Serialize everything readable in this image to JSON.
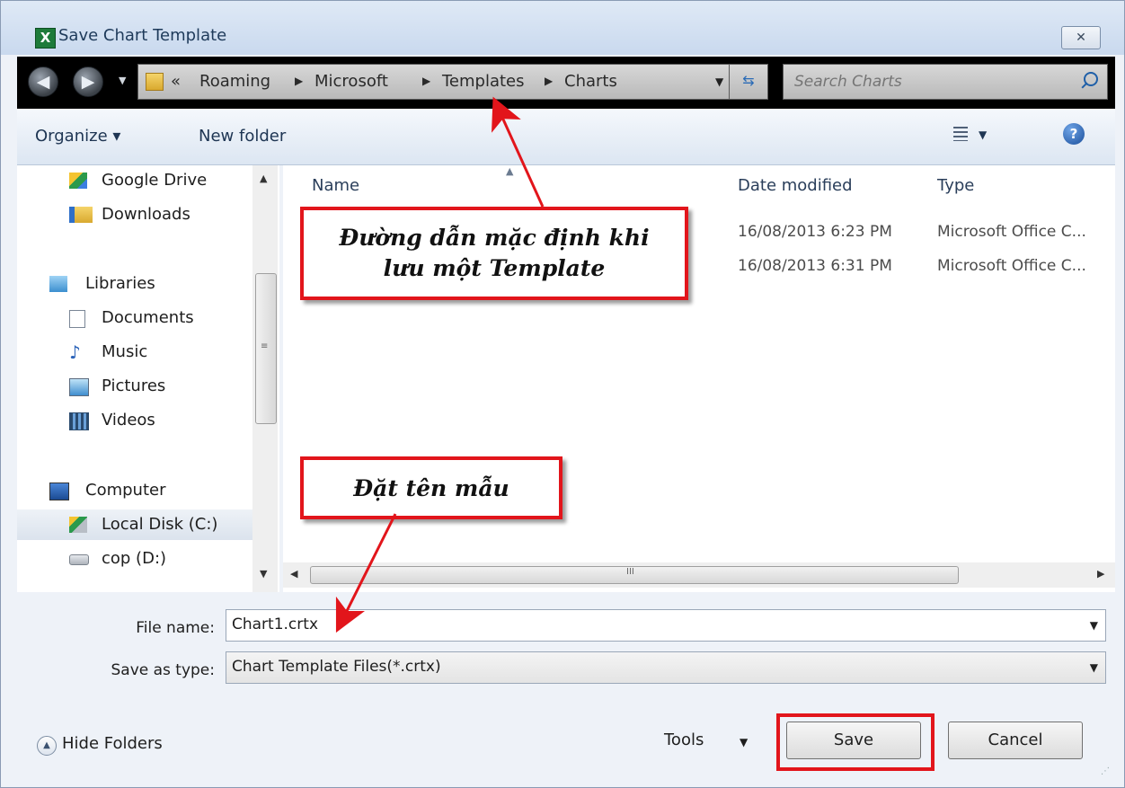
{
  "window": {
    "title": "Save Chart Template",
    "close_label": "✕"
  },
  "address_bar": {
    "crumb_prefix": "«",
    "crumbs": [
      "Roaming",
      "Microsoft",
      "Templates",
      "Charts"
    ],
    "search_placeholder": "Search Charts"
  },
  "toolbar": {
    "organize_label": "Organize ▾",
    "new_folder_label": "New folder"
  },
  "nav_pane": {
    "items": [
      {
        "label": "Google Drive",
        "icon": "google-drive-icon"
      },
      {
        "label": "Downloads",
        "icon": "downloads-icon"
      },
      {
        "label": "Libraries",
        "icon": "libraries-icon"
      },
      {
        "label": "Documents",
        "icon": "documents-icon"
      },
      {
        "label": "Music",
        "icon": "music-icon"
      },
      {
        "label": "Pictures",
        "icon": "pictures-icon"
      },
      {
        "label": "Videos",
        "icon": "videos-icon"
      },
      {
        "label": "Computer",
        "icon": "computer-icon"
      },
      {
        "label": "Local Disk (C:)",
        "icon": "local-disk-icon",
        "selected": true
      },
      {
        "label": "cop (D:)",
        "icon": "drive-icon"
      }
    ]
  },
  "file_list": {
    "columns": [
      "Name",
      "Date modified",
      "Type"
    ],
    "rows": [
      {
        "name": "",
        "date": "16/08/2013 6:23 PM",
        "type": "Microsoft Office C..."
      },
      {
        "name": "",
        "date": "16/08/2013 6:31 PM",
        "type": "Microsoft Office C..."
      }
    ]
  },
  "form": {
    "file_name_label": "File name:",
    "file_name_value": "Chart1.crtx",
    "save_type_label": "Save as type:",
    "save_type_value": "Chart Template Files(*.crtx)"
  },
  "footer": {
    "hide_folders_label": "Hide Folders",
    "tools_label": "Tools",
    "save_label": "Save",
    "cancel_label": "Cancel"
  },
  "annotations": {
    "path_note_line1": "Đường dẫn mặc định khi",
    "path_note_line2": "lưu một Template",
    "name_note": "Đặt tên mẫu"
  },
  "colors": {
    "annotation_red": "#e2151b",
    "address_bar_bg": "#000000",
    "toolbar_text": "#1e3553"
  }
}
